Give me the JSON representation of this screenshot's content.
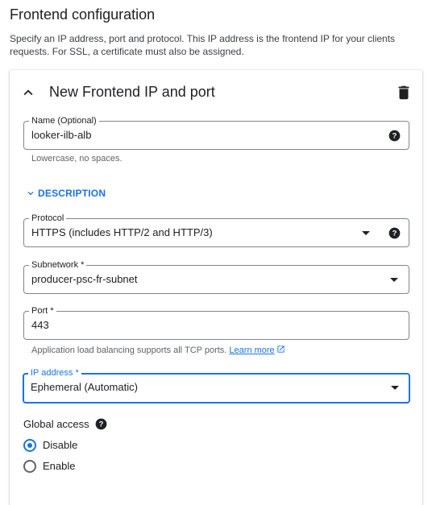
{
  "header": {
    "title": "Frontend configuration",
    "description": "Specify an IP address, port and protocol. This IP address is the frontend IP for your clients requests. For SSL, a certificate must also be assigned."
  },
  "card": {
    "title": "New Frontend IP and port",
    "collapse_icon": "chevron-up-icon",
    "delete_icon": "trash-icon"
  },
  "name_field": {
    "label": "Name (Optional)",
    "value": "looker-ilb-alb",
    "hint": "Lowercase, no spaces."
  },
  "description_toggle": {
    "label": "DESCRIPTION"
  },
  "protocol_field": {
    "label": "Protocol",
    "value": "HTTPS (includes HTTP/2 and HTTP/3)"
  },
  "subnetwork_field": {
    "label": "Subnetwork *",
    "value": "producer-psc-fr-subnet"
  },
  "port_field": {
    "label": "Port *",
    "value": "443",
    "hint": "Application load balancing supports all TCP ports.",
    "learn_more": "Learn more"
  },
  "ip_field": {
    "label": "IP address *",
    "value": "Ephemeral (Automatic)"
  },
  "global_access": {
    "label": "Global access",
    "options": [
      {
        "label": "Disable",
        "selected": true
      },
      {
        "label": "Enable",
        "selected": false
      }
    ]
  },
  "colors": {
    "accent": "#1a73e8",
    "text": "#202124",
    "secondary_text": "#5f6368"
  }
}
